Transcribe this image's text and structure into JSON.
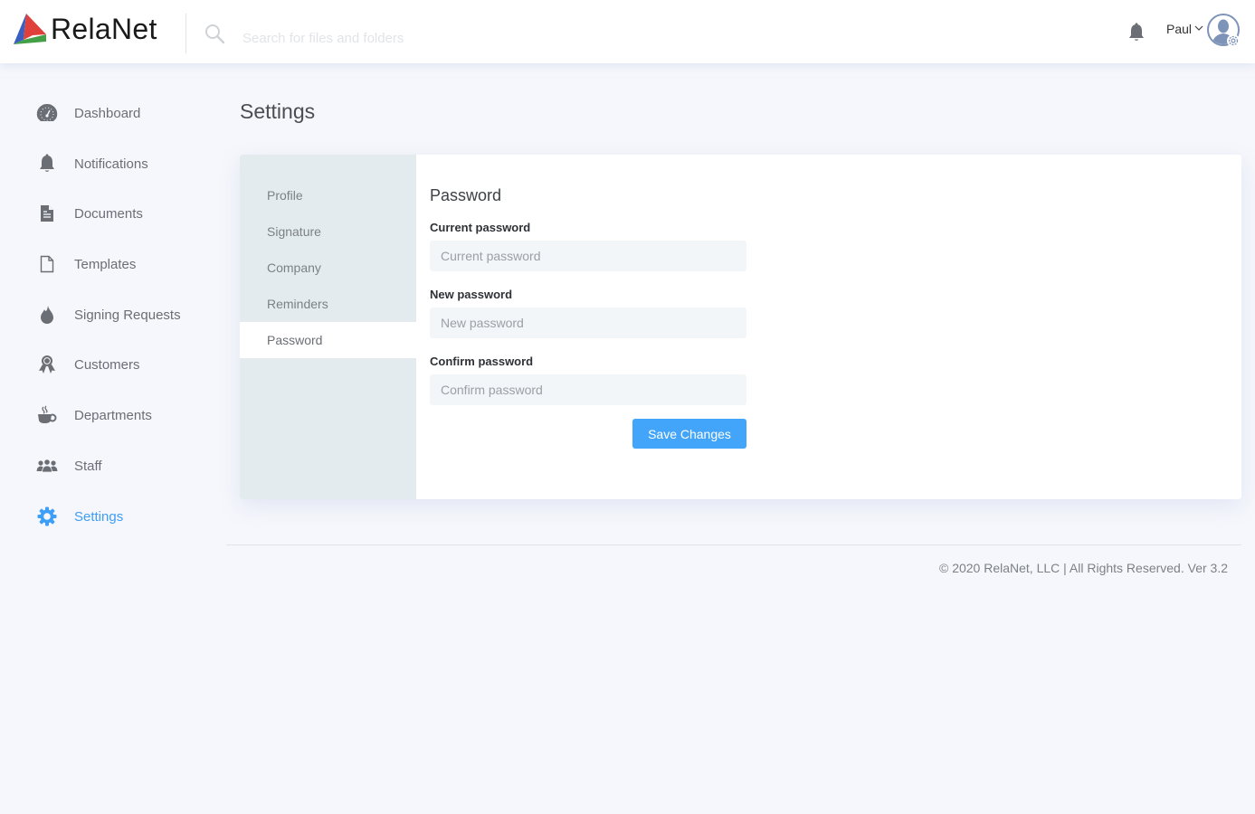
{
  "app": {
    "brand_name": "RelaNet",
    "accent_color": "#3d9ef8",
    "button_color": "#42a5f9"
  },
  "header": {
    "search": {
      "placeholder": "Search for files and folders",
      "value": "",
      "icon": "search-icon"
    },
    "notifications_icon": "bell-icon",
    "user": {
      "name": "Paul",
      "dropdown_icon": "chevron-down-icon",
      "avatar_icon": "user-settings-avatar"
    }
  },
  "sidebar": {
    "items": [
      {
        "label": "Dashboard",
        "icon": "dashboard-icon",
        "active": false
      },
      {
        "label": "Notifications",
        "icon": "bell-icon",
        "active": false
      },
      {
        "label": "Documents",
        "icon": "document-icon",
        "active": false
      },
      {
        "label": "Templates",
        "icon": "file-icon",
        "active": false
      },
      {
        "label": "Signing Requests",
        "icon": "fire-icon",
        "active": false
      },
      {
        "label": "Customers",
        "icon": "award-icon",
        "active": false
      },
      {
        "label": "Departments",
        "icon": "coffee-icon",
        "active": false
      },
      {
        "label": "Staff",
        "icon": "users-icon",
        "active": false
      },
      {
        "label": "Settings",
        "icon": "gear-icon",
        "active": true
      }
    ]
  },
  "main": {
    "page_title": "Settings",
    "settings_tabs": [
      {
        "label": "Profile",
        "active": false
      },
      {
        "label": "Signature",
        "active": false
      },
      {
        "label": "Company",
        "active": false
      },
      {
        "label": "Reminders",
        "active": false
      },
      {
        "label": "Password",
        "active": true
      }
    ],
    "form": {
      "title": "Password",
      "fields": [
        {
          "label": "Current password",
          "placeholder": "Current password",
          "value": ""
        },
        {
          "label": "New password",
          "placeholder": "New password",
          "value": ""
        },
        {
          "label": "Confirm password",
          "placeholder": "Confirm password",
          "value": ""
        }
      ],
      "save_label": "Save Changes"
    }
  },
  "footer": {
    "text": "© 2020 RelaNet, LLC | All Rights Reserved. Ver 3.2"
  }
}
